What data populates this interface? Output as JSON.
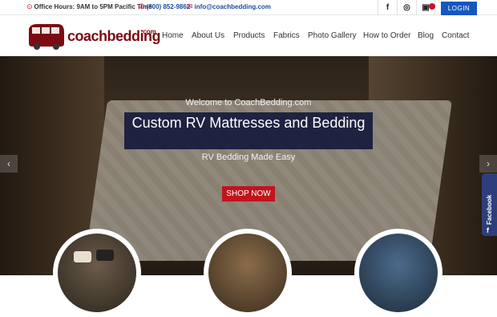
{
  "topbar": {
    "hours_icon": "clock-icon",
    "hours": "Office Hours: 9AM to 5PM Pacific Time",
    "phone_icon": "phone-icon",
    "phone": "(800) 852-9862",
    "email_icon": "email-icon",
    "email": "info@coachbedding.com",
    "social": [
      {
        "name": "facebook-icon",
        "glyph": "f"
      },
      {
        "name": "instagram-icon",
        "glyph": "◎"
      },
      {
        "name": "cart-icon",
        "glyph": "🛒"
      }
    ],
    "login_label": "LOGIN"
  },
  "logo": {
    "brand": "coachbedding",
    "tld": ".com"
  },
  "nav": {
    "items": [
      "Home",
      "About Us",
      "Products",
      "Fabrics",
      "Photo Gallery",
      "How to Order",
      "Blog",
      "Contact"
    ]
  },
  "hero": {
    "welcome": "Welcome to CoachBedding.com",
    "headline": "Custom RV Mattresses and Bedding",
    "tagline": "RV Bedding Made Easy",
    "cta": "SHOP NOW",
    "prev_icon": "chevron-left-icon",
    "next_icon": "chevron-right-icon"
  },
  "facebook_tab": {
    "label": "Facebook",
    "icon": "facebook-icon"
  },
  "colors": {
    "brand_red": "#c0141e",
    "login_blue": "#1557c0",
    "headline_bg": "#151a3c"
  }
}
